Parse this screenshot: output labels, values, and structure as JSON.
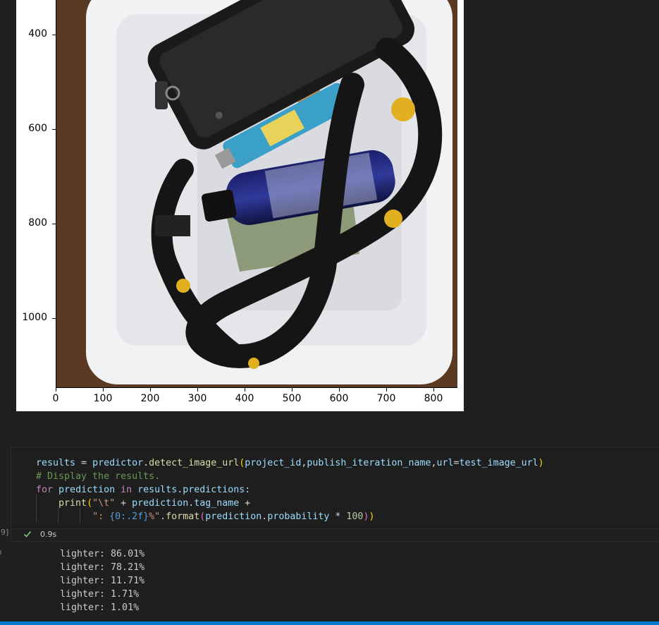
{
  "plot": {
    "y_ticks": [
      "400",
      "600",
      "800",
      "1000"
    ],
    "x_ticks": [
      "0",
      "100",
      "200",
      "300",
      "400",
      "500",
      "600",
      "700",
      "800"
    ],
    "image_content": "photo-of-tray-with-phone-lighter-bottle-lanyard"
  },
  "code": {
    "lines": [
      "results = predictor.detect_image_url(project_id,publish_iteration_name,url=test_image_url)",
      "# Display the results.",
      "for prediction in results.predictions:",
      "    print(\"\\t\" + prediction.tag_name +",
      "          \": {0:.2f}%\".format(prediction.probability * 100))"
    ]
  },
  "exec": {
    "count": "9]",
    "time": "0.9s",
    "status_icon": "check-icon"
  },
  "output": {
    "lines": [
      "lighter: 86.01%",
      "lighter: 78.21%",
      "lighter: 11.71%",
      "lighter: 1.71%",
      "lighter: 1.01%"
    ]
  },
  "colors": {
    "editor_bg": "#1e1e1e",
    "status_bar": "#007acc",
    "success": "#89d185"
  }
}
